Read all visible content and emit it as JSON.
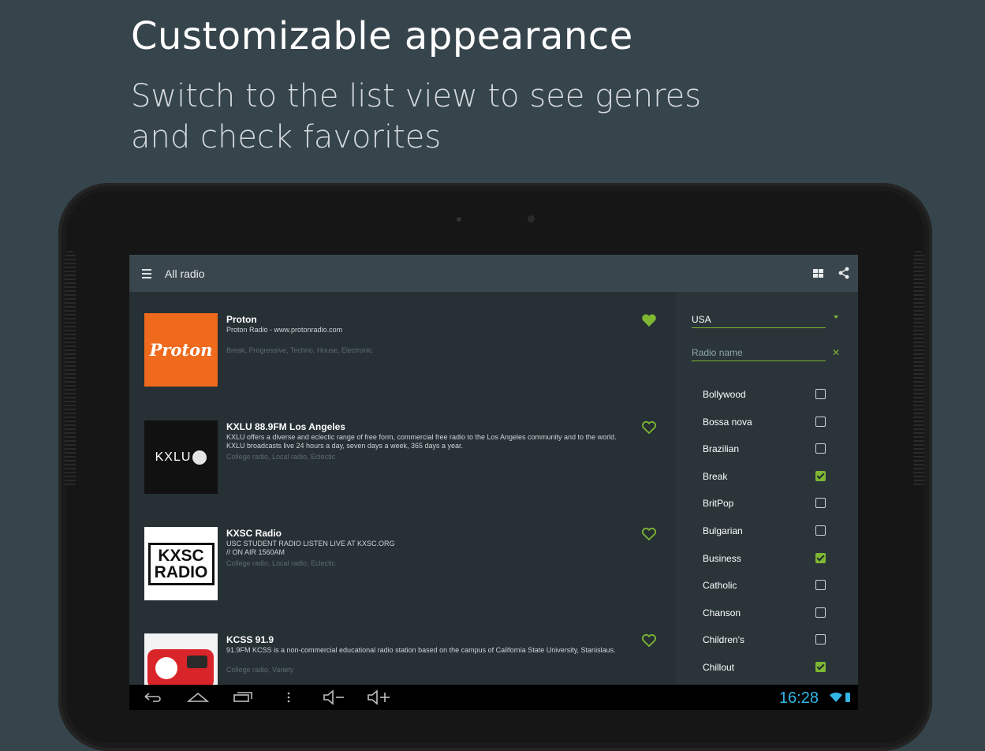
{
  "headline": "Customizable appearance",
  "subline": "Switch to the list view to see genres and check favorites",
  "action_bar": {
    "title": "All radio",
    "menu_icon": "menu-icon",
    "grid_icon": "grid-view-icon",
    "share_icon": "share-icon"
  },
  "stations": [
    {
      "name": "Proton",
      "desc": "Proton Radio - www.protonradio.com",
      "genres": "Break, Progressive, Techno, House, Electronic",
      "favorite": true,
      "logo_text": "Proton"
    },
    {
      "name": "KXLU 88.9FM Los Angeles",
      "desc": "KXLU offers a diverse and eclectic range of free form, commercial free radio to the Los Angeles community and to the world. KXLU broadcasts live 24 hours a day, seven days a week, 365 days a year.",
      "genres": "College radio, Local radio, Eclectic",
      "favorite": false,
      "logo_text": "KXLU"
    },
    {
      "name": "KXSC Radio",
      "desc": "USC STUDENT RADIO LISTEN LIVE AT KXSC.ORG // ON AIR 1560AM",
      "genres": "College radio, Local radio, Eclectic",
      "favorite": false,
      "logo_text": "KXSC RADIO"
    },
    {
      "name": "KCSS 91.9",
      "desc": "91.9FM KCSS is a non-commercial educational radio station based on the campus of California State University, Stanislaus.",
      "genres": "College radio, Variety",
      "favorite": false,
      "logo_text": ""
    }
  ],
  "filters": {
    "country": "USA",
    "radio_name_placeholder": "Radio name",
    "genres": [
      {
        "label": "Bollywood",
        "checked": false
      },
      {
        "label": "Bossa nova",
        "checked": false
      },
      {
        "label": "Brazilian",
        "checked": false
      },
      {
        "label": "Break",
        "checked": true
      },
      {
        "label": "BritPop",
        "checked": false
      },
      {
        "label": "Bulgarian",
        "checked": false
      },
      {
        "label": "Business",
        "checked": true
      },
      {
        "label": "Catholic",
        "checked": false
      },
      {
        "label": "Chanson",
        "checked": false
      },
      {
        "label": "Children's",
        "checked": false
      },
      {
        "label": "Chillout",
        "checked": true
      }
    ]
  },
  "status_bar": {
    "time": "16:28"
  },
  "colors": {
    "accent": "#7fb733",
    "background": "#36444c",
    "clock": "#33b5e5"
  }
}
